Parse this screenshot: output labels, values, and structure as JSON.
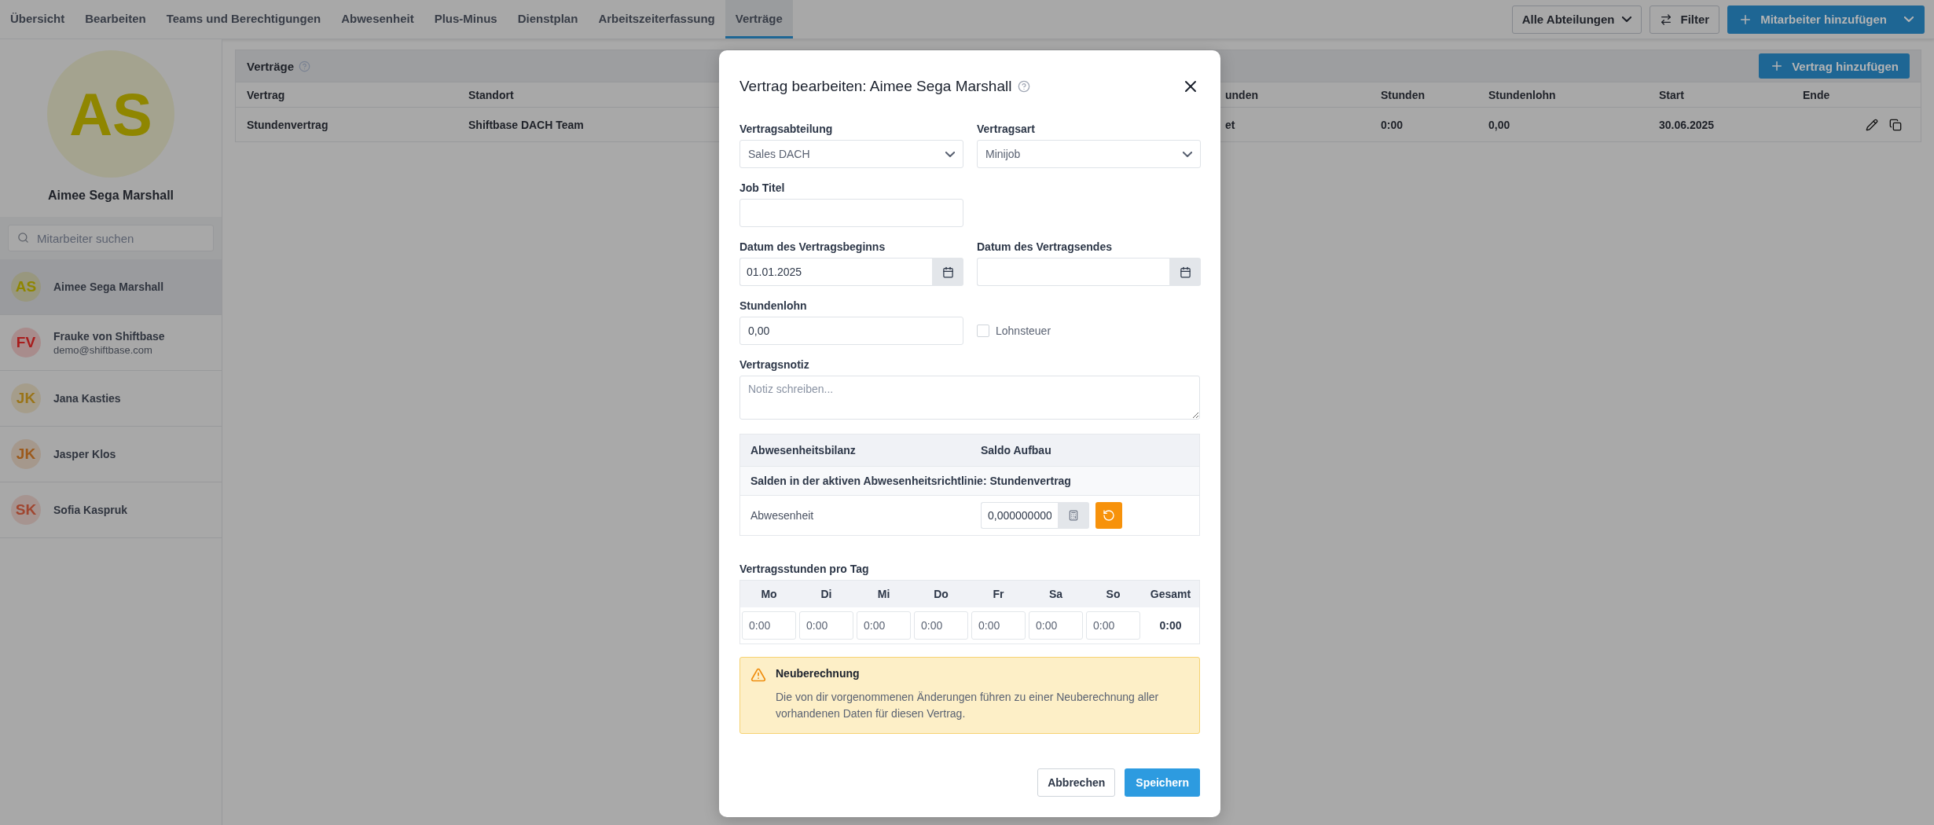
{
  "nav": {
    "tabs": [
      {
        "label": "Übersicht",
        "selected": false
      },
      {
        "label": "Bearbeiten",
        "selected": false
      },
      {
        "label": "Teams und Berechtigungen",
        "selected": false
      },
      {
        "label": "Abwesenheit",
        "selected": false
      },
      {
        "label": "Plus-Minus",
        "selected": false
      },
      {
        "label": "Dienstplan",
        "selected": false
      },
      {
        "label": "Arbeitszeiterfassung",
        "selected": false
      },
      {
        "label": "Verträge",
        "selected": true
      }
    ],
    "department_filter": "Alle Abteilungen",
    "filter_button": "Filter",
    "add_employee_button": "Mitarbeiter hinzufügen"
  },
  "sidebar": {
    "profile": {
      "initials": "AS",
      "name": "Aimee Sega Marshall",
      "color": "#8f8600"
    },
    "search": {
      "placeholder": "Mitarbeiter suchen"
    },
    "employees": [
      {
        "initials": "AS",
        "name": "Aimee Sega Marshall",
        "color": "#8f8600",
        "selected": true
      },
      {
        "initials": "FV",
        "name": "Frauke von Shiftbase",
        "subtitle": "demo@shiftbase.com",
        "color": "#a81c1c",
        "selected": false
      },
      {
        "initials": "JK",
        "name": "Jana Kasties",
        "color": "#9a7418",
        "selected": false
      },
      {
        "initials": "JK",
        "name": "Jasper Klos",
        "color": "#9c5a1c",
        "selected": false
      },
      {
        "initials": "SK",
        "name": "Sofia Kaspruk",
        "color": "#a04630",
        "selected": false
      }
    ]
  },
  "contracts": {
    "title": "Verträge",
    "add_button": "Vertrag hinzufügen",
    "table": {
      "columns": [
        "Vertrag",
        "Standort",
        "unden",
        "Stunden",
        "Stundenlohn",
        "Start",
        "Ende"
      ],
      "rows": [
        {
          "cells": [
            "Stundenvertrag",
            "Shiftbase DACH Team",
            "et",
            "0:00",
            "0,00",
            "30.06.2025"
          ]
        }
      ]
    }
  },
  "dialog": {
    "title": "Vertrag bearbeiten: Aimee Sega Marshall",
    "department": {
      "label": "Vertragsabteilung",
      "value": "Sales DACH"
    },
    "contract_type": {
      "label": "Vertragsart",
      "value": "Minijob"
    },
    "job_title": {
      "label": "Job Titel"
    },
    "start_date": {
      "label": "Datum des Vertragsbeginns",
      "value": "01.01.2025"
    },
    "end_date": {
      "label": "Datum des Vertragsendes"
    },
    "hourly_wage": {
      "label": "Stundenlohn",
      "value": "0,00"
    },
    "tax_checkbox": {
      "label": "Lohnsteuer",
      "checked": false
    },
    "note": {
      "label": "Vertragsnotiz",
      "placeholder": "Notiz schreiben..."
    },
    "absence_balance": {
      "columns": [
        "Abwesenheitsbilanz",
        "Saldo Aufbau"
      ],
      "policy_note": "Salden in der aktiven Abwesenheitsrichtlinie: Stundenvertrag",
      "rows": [
        {
          "label": "Abwesenheit",
          "value": "0,000000000"
        }
      ]
    },
    "hours_per_day": {
      "label": "Vertragsstunden pro Tag",
      "days": [
        {
          "day": "Mo",
          "value": "0:00"
        },
        {
          "day": "Di",
          "value": "0:00"
        },
        {
          "day": "Mi",
          "value": "0:00"
        },
        {
          "day": "Do",
          "value": "0:00"
        },
        {
          "day": "Fr",
          "value": "0:00"
        },
        {
          "day": "Sa",
          "value": "0:00"
        },
        {
          "day": "So",
          "value": "0:00"
        }
      ],
      "total_label": "Gesamt",
      "total": "0:00"
    },
    "warning": {
      "title": "Neuberechnung",
      "text": "Die von dir vorgenommenen Änderungen führen zu einer Neuberechnung aller vorhandenen Daten für diesen Vertrag."
    },
    "cancel_button": "Abbrechen",
    "save_button": "Speichern"
  }
}
